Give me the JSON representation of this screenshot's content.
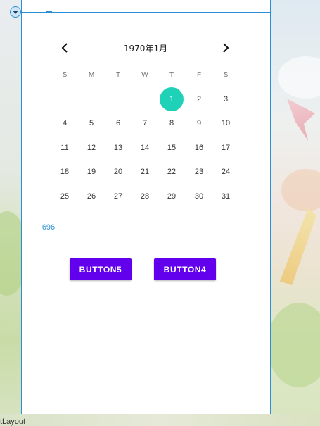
{
  "designer": {
    "dimension_label": "696",
    "bottom_label": "tLayout"
  },
  "calendar": {
    "month_title": "1970年1月",
    "weekdays": [
      "S",
      "M",
      "T",
      "W",
      "T",
      "F",
      "S"
    ],
    "weeks": [
      [
        "",
        "",
        "",
        "",
        "1",
        "2",
        "3"
      ],
      [
        "4",
        "5",
        "6",
        "7",
        "8",
        "9",
        "10"
      ],
      [
        "11",
        "12",
        "13",
        "14",
        "15",
        "16",
        "17"
      ],
      [
        "18",
        "19",
        "20",
        "21",
        "22",
        "23",
        "24"
      ],
      [
        "25",
        "26",
        "27",
        "28",
        "29",
        "30",
        "31"
      ]
    ],
    "selected_day": "1",
    "selected_color": "#1fd2b7",
    "prev_icon": "chevron-left-icon",
    "next_icon": "chevron-right-icon"
  },
  "buttons": {
    "button5_label": "BUTTON5",
    "button4_label": "BUTTON4",
    "color": "#6200ee"
  }
}
